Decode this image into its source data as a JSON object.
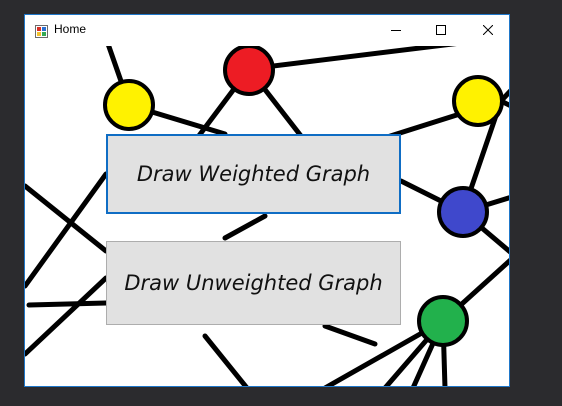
{
  "window": {
    "title": "Home",
    "app_icon": "winforms-app-icon",
    "controls": {
      "minimize_icon": "minimize-icon",
      "maximize_icon": "maximize-icon",
      "close_icon": "close-icon"
    }
  },
  "buttons": {
    "weighted_label": "Draw Weighted Graph",
    "unweighted_label": "Draw Unweighted Graph"
  },
  "graph": {
    "node_colors": {
      "red": "#ed1c24",
      "yellow": "#fff200",
      "blue": "#3f48cc",
      "green": "#22b14c",
      "navy": "#1e2a6e"
    },
    "edge_color": "#000000"
  },
  "colors": {
    "window_border": "#1f77c9",
    "focused_button_border": "#0f6dc4",
    "button_face": "#e1e1e1",
    "desktop": "#2b2b2e"
  }
}
